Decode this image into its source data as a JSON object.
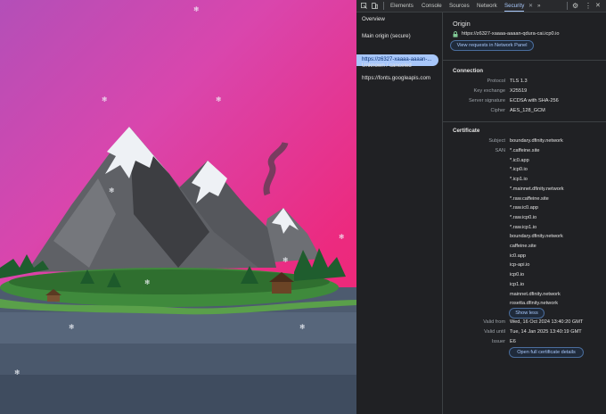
{
  "devtools": {
    "tabs": [
      "Elements",
      "Console",
      "Sources",
      "Network",
      "Security"
    ],
    "active_tab": "Security",
    "more_tabs": "»",
    "icons": [
      "inspect-icon",
      "device-icon",
      "settings-icon",
      "more-icon",
      "close-icon"
    ]
  },
  "sidebar": {
    "overview": "Overview",
    "main_origin_heading": "Main origin (secure)",
    "main_origin": "https://z6327-xaaaa-aaaan-...",
    "unknown_heading": "Unknown / canceled",
    "unknown_origin": "https://fonts.googleapis.com"
  },
  "origin": {
    "title": "Origin",
    "url": "https://z6327-xaaaa-aaaan-qdura-cai.icp0.io",
    "button": "View requests in Network Panel"
  },
  "connection": {
    "title": "Connection",
    "rows": [
      {
        "label": "Protocol",
        "value": "TLS 1.3"
      },
      {
        "label": "Key exchange",
        "value": "X25519"
      },
      {
        "label": "Server signature",
        "value": "ECDSA with SHA-256"
      },
      {
        "label": "Cipher",
        "value": "AES_128_GCM"
      }
    ]
  },
  "certificate": {
    "title": "Certificate",
    "subject_label": "Subject",
    "subject": "boundary.dfinity.network",
    "san_label": "SAN",
    "san": [
      "*.caffeine.site",
      "*.ic0.app",
      "*.icp0.io",
      "*.icp1.io",
      "*.mainnet.dfinity.network",
      "*.raw.caffeine.site",
      "*.raw.ic0.app",
      "*.raw.icp0.io",
      "*.raw.icp1.io",
      "boundary.dfinity.network",
      "caffeine.site",
      "ic0.app",
      "icp-api.io",
      "icp0.io",
      "icp1.io",
      "mainnet.dfinity.network",
      "rosetta.dfinity.network"
    ],
    "show_less": "Show less",
    "valid_from_label": "Valid from",
    "valid_from": "Wed, 16 Oct 2024 13:40:20 GMT",
    "valid_until_label": "Valid until",
    "valid_until": "Tue, 14 Jan 2025 13:40:19 GMT",
    "issuer_label": "Issuer",
    "issuer": "E6",
    "open_button": "Open full certificate details"
  },
  "colors": {
    "accent": "#a8c7fa",
    "secure": "#81c995",
    "panel": "#202124"
  }
}
